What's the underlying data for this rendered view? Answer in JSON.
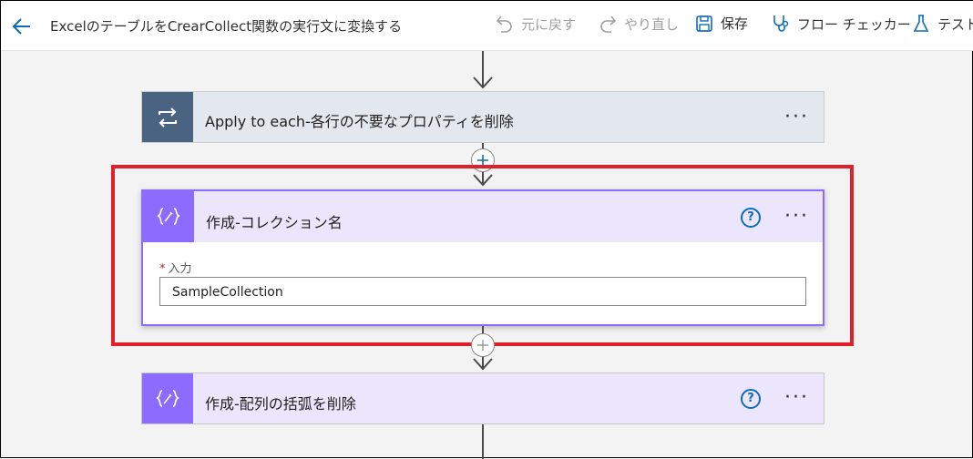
{
  "header": {
    "title": "ExcelのテーブルをCrearCollect関数の実行文に変換する",
    "undo_label": "元に戻す",
    "redo_label": "やり直し",
    "save_label": "保存",
    "checker_label": "フロー チェッカー",
    "test_label": "テスト"
  },
  "steps": {
    "apply_each": {
      "title": "Apply to each-各行の不要なプロパティを削除",
      "more": "···"
    },
    "compose_collection": {
      "title": "作成-コレクション名",
      "help": "?",
      "more": "···",
      "input_label": "入力",
      "required_mark": "*",
      "input_value": "SampleCollection"
    },
    "compose_brackets": {
      "title": "作成-配列の括弧を削除",
      "help": "?",
      "more": "···"
    }
  },
  "colors": {
    "control_accent": "#4a6381",
    "compose_accent": "#8c6cff",
    "highlight": "#e0202a",
    "link_blue": "#0f6cbd"
  }
}
